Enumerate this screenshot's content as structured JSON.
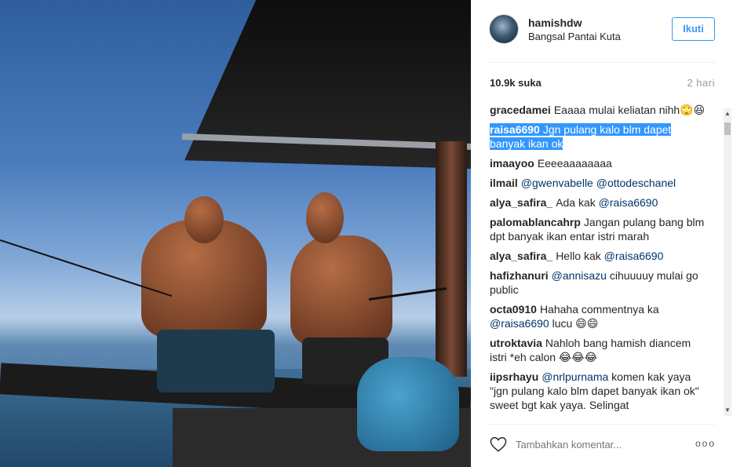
{
  "post": {
    "username": "hamishdw",
    "location": "Bangsal Pantai Kuta",
    "follow_label": "Ikuti",
    "likes": "10.9k suka",
    "time": "2 hari"
  },
  "comments": [
    {
      "user": "gracedamei",
      "text": "Eaaaa mulai keliatan nihh🙄😆"
    },
    {
      "user": "raisa6690",
      "text": "Jgn pulang kalo blm dapet banyak ikan ok",
      "selected": true
    },
    {
      "user": "imaayoo",
      "text": "Eeeeaaaaaaaa"
    },
    {
      "user": "ilmail",
      "mentions": [
        "@gwenvabelle",
        "@ottodeschanel"
      ]
    },
    {
      "user": "alya_safira_",
      "text": "Ada kak",
      "mention": "@raisa6690"
    },
    {
      "user": "palomablancahrp",
      "text": "Jangan pulang bang blm dpt banyak ikan entar istri marah"
    },
    {
      "user": "alya_safira_",
      "text": "Hello kak",
      "mention": "@raisa6690"
    },
    {
      "user": "hafizhanuri",
      "mention": "@annisazu",
      "text": "cihuuuuy mulai go public"
    },
    {
      "user": "octa0910",
      "text": "Hahaha commentnya ka",
      "mention": "@raisa6690",
      "text2": "lucu 😄😄"
    },
    {
      "user": "utroktavia",
      "text": "Nahloh bang hamish diancem istri *eh calon 😂😂😂"
    },
    {
      "user": "iipsrhayu",
      "mention": "@nrlpurnama",
      "text": "komen kak yaya \"jgn pulang kalo blm dapet banyak ikan ok\" sweet bgt kak yaya. Selingat"
    }
  ],
  "footer": {
    "comment_placeholder": "Tambahkan komentar...",
    "more_label": "ooo"
  },
  "colors": {
    "accent": "#3897f0",
    "mention": "#003569",
    "selection": "#3297fd"
  }
}
